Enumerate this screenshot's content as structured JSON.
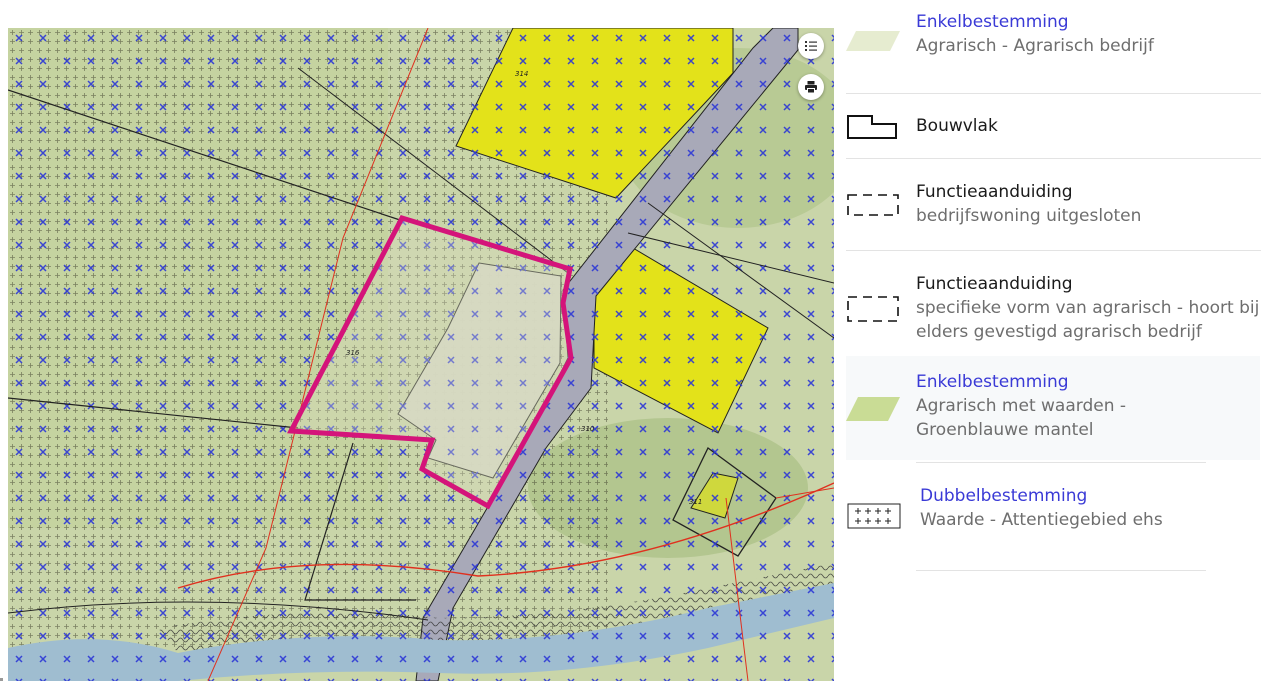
{
  "map": {
    "parcel_labels": [
      "314",
      "316",
      "310",
      "311"
    ],
    "colors": {
      "agrarisch_base": "#c9d5a9",
      "bedrijf_yellow": "#e3e21a",
      "selection_magenta": "#d4147a",
      "road": "#a8a9b8",
      "water": "#9fbdd0",
      "cross_blue": "#2b36d6",
      "red_line": "#e0301e"
    },
    "controls": [
      {
        "name": "legend-toggle-icon"
      },
      {
        "name": "print-icon"
      }
    ]
  },
  "legend": {
    "items": [
      {
        "title": "Enkelbestemming",
        "subtitle": "Agrarisch - Agrarisch bedrijf",
        "title_link": true
      },
      {
        "title": "Bouwvlak",
        "subtitle": "",
        "title_link": false
      },
      {
        "title": "Functieaanduiding",
        "subtitle": "bedrijfswoning uitgesloten",
        "title_link": false
      },
      {
        "title": "Functieaanduiding",
        "subtitle": "specifieke vorm van agrarisch - hoort bij elders gevestigd agrarisch bedrijf",
        "title_link": false
      },
      {
        "title": "Enkelbestemming",
        "subtitle": "Agrarisch met waarden - Groenblauwe mantel",
        "title_link": true
      },
      {
        "title": "Dubbelbestemming",
        "subtitle": "Waarde - Attentiegebied ehs",
        "title_link": true
      }
    ]
  }
}
